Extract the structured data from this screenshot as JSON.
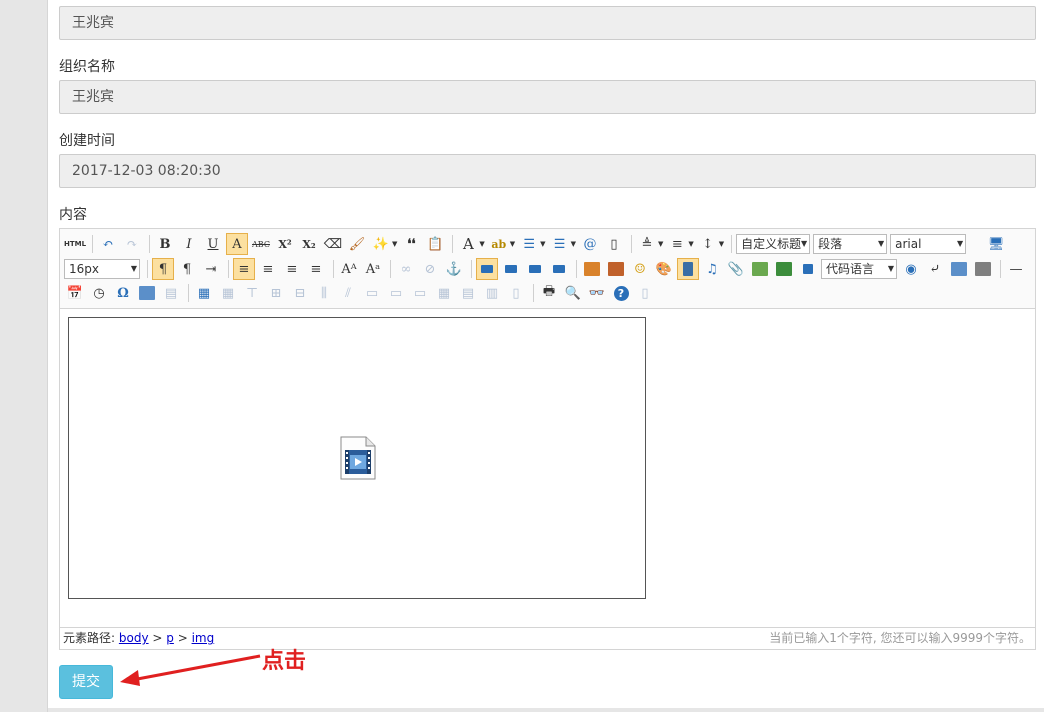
{
  "form": {
    "fields": [
      {
        "label": "",
        "value": "王兆宾"
      },
      {
        "label": "组织名称",
        "value": "王兆宾"
      },
      {
        "label": "创建时间",
        "value": "2017-12-03 08:20:30"
      }
    ],
    "content_label": "内容"
  },
  "editor": {
    "toolbar": {
      "html_label": "HTML",
      "bold": "B",
      "italic": "I",
      "underline": "U",
      "fontborder": "A",
      "strike": "ABC",
      "sup": "X²",
      "sub": "X₂",
      "quote": "❛❛",
      "fontcolor": "A",
      "backcolor": "ab",
      "custom_heading": "自定义标题",
      "paragraph": "段落",
      "font_family": "arial",
      "font_size": "16px",
      "code_language": "代码语言",
      "omega": "Ω",
      "help": "?"
    },
    "status": {
      "path_label": "元素路径:",
      "path": [
        "body",
        "p",
        "img"
      ],
      "word_count": "当前已输入1个字符, 您还可以输入9999个字符。"
    }
  },
  "submit_label": "提交",
  "annotation_text": "点击",
  "colors": {
    "submit_bg": "#5bc0de",
    "annotation": "#e02020"
  }
}
